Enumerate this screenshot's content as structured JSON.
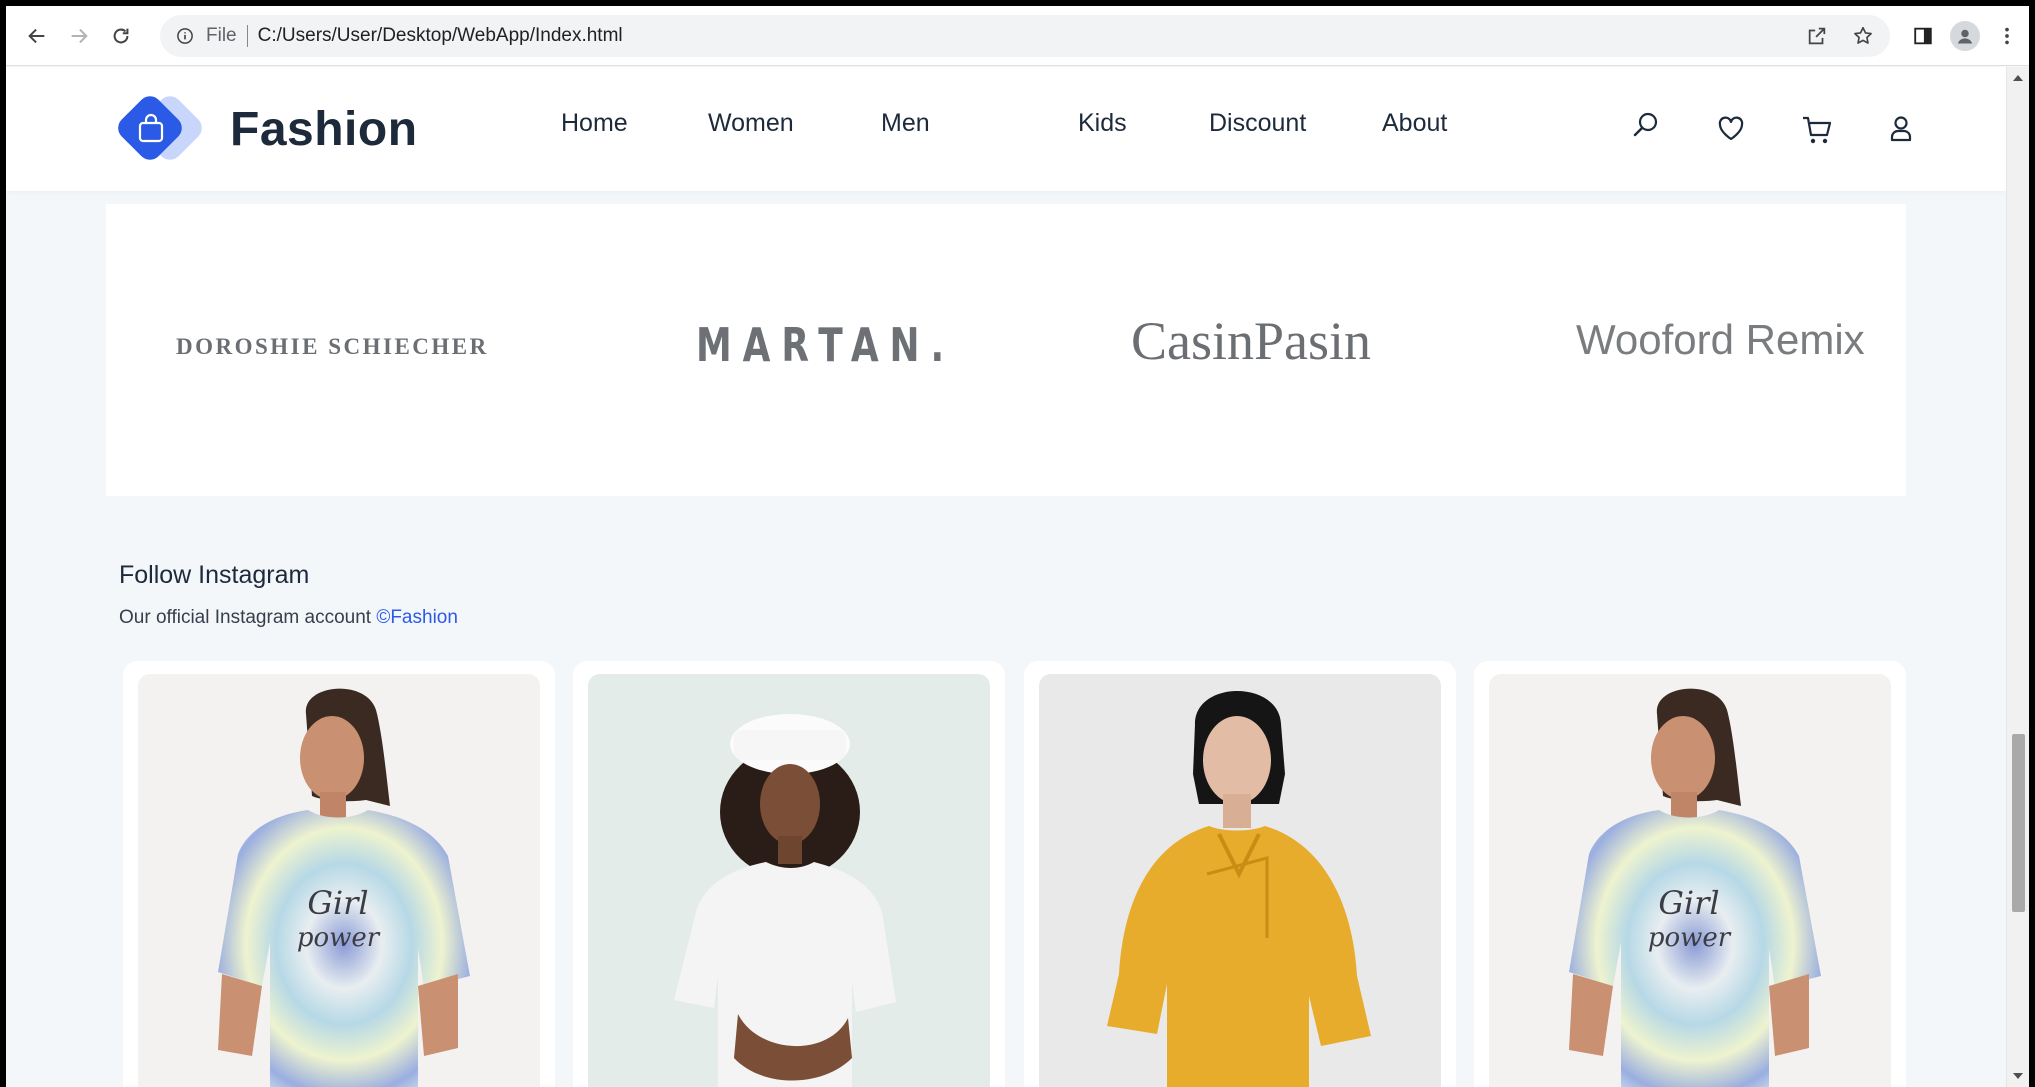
{
  "browser": {
    "file_label": "File",
    "url": "C:/Users/User/Desktop/WebApp/Index.html"
  },
  "site": {
    "brand_name": "Fashion",
    "nav": [
      "Home",
      "Women",
      "Men",
      "Kids",
      "Discount",
      "About"
    ],
    "header_icons": [
      "search-icon",
      "heart-icon",
      "cart-icon",
      "user-icon"
    ],
    "accent_color": "#2b5be6"
  },
  "brands": [
    "DOROSHIE SCHIECHER",
    "MARTAN.",
    "CasinPasin",
    "Wooford Remix"
  ],
  "instagram": {
    "title": "Follow Instagram",
    "subtitle": "Our official Instagram account",
    "handle": "©Fashion",
    "photos": [
      {
        "name": "photo-tie-dye-tshirt",
        "shirt_color": "#dfe9ee"
      },
      {
        "name": "photo-white-tshirt-bucket-hat",
        "shirt_color": "#f4f4f4"
      },
      {
        "name": "photo-mustard-top",
        "shirt_color": "#e7ac2b"
      },
      {
        "name": "photo-tie-dye-tshirt-2",
        "shirt_color": "#dfe9ee"
      }
    ]
  }
}
